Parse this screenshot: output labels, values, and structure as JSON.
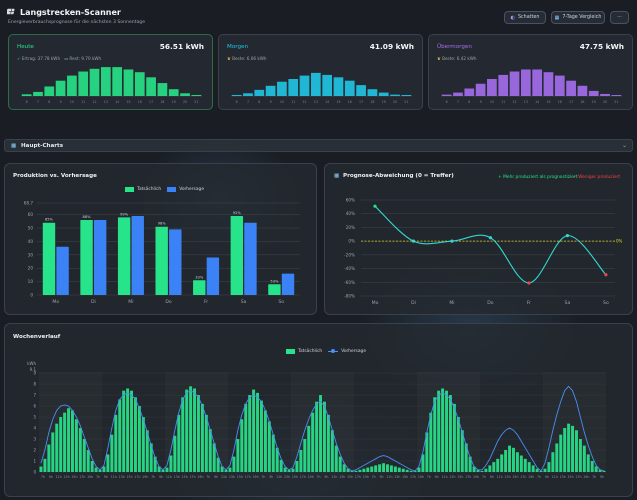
{
  "header": {
    "title": "Langstrecken-Scanner",
    "subtitle": "Energieverbrauchsprognose für die nächsten 3 Sonnentage",
    "btn_shade": "Schatten",
    "btn_compare": "7-Tage Vergleich",
    "btn_more": "···"
  },
  "colors": {
    "green": "#27e38a",
    "cyan": "#1fc7e6",
    "purple": "#a66ef0",
    "blue": "#3b82f6",
    "red": "#ef4444",
    "yellow": "#e6d21a"
  },
  "days": [
    {
      "name": "Heute",
      "value": "56.51 kWh",
      "meta1": "Ertrag: 37.78 kWh",
      "meta2": "Rest: 9.70 kWh",
      "color": "#27e38a",
      "bars": [
        0.05,
        0.12,
        0.28,
        0.45,
        0.6,
        0.72,
        0.8,
        0.85,
        0.85,
        0.78,
        0.7,
        0.55,
        0.38,
        0.2,
        0.08,
        0.03
      ]
    },
    {
      "name": "Morgen",
      "value": "41.09 kWh",
      "meta1": "Beste: 6.06 kWh",
      "color": "#1fc7e6",
      "bars": [
        0.03,
        0.08,
        0.18,
        0.3,
        0.42,
        0.5,
        0.6,
        0.68,
        0.62,
        0.55,
        0.45,
        0.32,
        0.2,
        0.1,
        0.04,
        0.02
      ]
    },
    {
      "name": "Übermorgen",
      "value": "47.75 kWh",
      "meta1": "Beste: 6.42 kWh",
      "color": "#a66ef0",
      "bars": [
        0.04,
        0.1,
        0.22,
        0.36,
        0.5,
        0.62,
        0.72,
        0.78,
        0.78,
        0.7,
        0.6,
        0.45,
        0.3,
        0.15,
        0.06,
        0.02
      ]
    }
  ],
  "day_hour_labels": [
    "6",
    "7",
    "8",
    "9",
    "10",
    "11",
    "12",
    "13",
    "14",
    "15",
    "16",
    "17",
    "18",
    "19",
    "20",
    "21"
  ],
  "section": {
    "title": "Haupt-Charts",
    "chevron": "⌄"
  },
  "chart_data": [
    {
      "type": "bar",
      "title": "Produktion vs. Vorhersage",
      "categories": [
        "Mo",
        "Di",
        "Mi",
        "Do",
        "Fr",
        "Sa",
        "So"
      ],
      "series": [
        {
          "name": "Tatsächlich",
          "values": [
            54,
            56,
            58,
            51,
            11,
            59,
            8
          ]
        },
        {
          "name": "Vorhersage",
          "values": [
            36,
            56,
            59,
            49,
            28,
            54,
            16
          ]
        }
      ],
      "data_labels": [
        "85%",
        "88%",
        "99%",
        "98%",
        "33%",
        "92%",
        "53%"
      ],
      "ylim": [
        0,
        68.7
      ],
      "yticks": [
        "0",
        "10",
        "20",
        "30",
        "40",
        "50",
        "60",
        "68.7"
      ],
      "grid": true,
      "legend": "top"
    },
    {
      "type": "line",
      "title": "Prognose-Abweichung (0 = Treffer)",
      "legend_plus": "+ Mehr produziert als prognostiziert",
      "legend_minus": "− Weniger produziert",
      "categories": [
        "Mo",
        "Di",
        "Mi",
        "Do",
        "Fr",
        "Sa",
        "So"
      ],
      "values": [
        51,
        0,
        0,
        5,
        -61,
        8,
        -49
      ],
      "ylim": [
        -80,
        60
      ],
      "yticks": [
        "60%",
        "40%",
        "20%",
        "0%",
        "-20%",
        "-40%",
        "-60%",
        "-80%"
      ],
      "zero_label": "0%",
      "grid": true
    },
    {
      "type": "bar",
      "title": "Wochenverlauf",
      "ylabel": "kWh",
      "ymax_label": "9.1",
      "yticks": [
        "0",
        "1",
        "2",
        "3",
        "4",
        "5",
        "6",
        "7",
        "8",
        "9"
      ],
      "ylim": [
        0,
        9.1
      ],
      "legend": [
        "Tatsächlich",
        "Vorhersage"
      ],
      "x_tick_pattern": [
        "7h",
        "9h",
        "11h",
        "13h",
        "15h",
        "17h",
        "19h"
      ],
      "series": [
        {
          "name": "Tatsächlich",
          "values": [
            0.5,
            1.2,
            2.5,
            3.6,
            4.4,
            5.0,
            5.4,
            5.8,
            5.6,
            4.8,
            4.0,
            3.0,
            2.0,
            1.0,
            0.4,
            0.2,
            0.5,
            1.6,
            3.4,
            5.2,
            6.6,
            7.4,
            7.6,
            7.4,
            6.8,
            6.0,
            5.0,
            3.8,
            2.6,
            1.4,
            0.5,
            0.2,
            0.4,
            1.5,
            3.3,
            5.2,
            6.8,
            7.5,
            7.8,
            7.6,
            7.0,
            6.2,
            5.2,
            3.9,
            2.6,
            1.3,
            0.5,
            0.2,
            0.4,
            1.4,
            3.0,
            4.8,
            6.2,
            7.0,
            7.5,
            7.2,
            6.5,
            5.6,
            4.6,
            3.4,
            2.2,
            1.1,
            0.4,
            0.2,
            0.3,
            1.0,
            2.0,
            3.0,
            4.2,
            5.4,
            6.4,
            7.0,
            6.4,
            5.2,
            3.8,
            2.4,
            1.4,
            0.7,
            0.3,
            0.1,
            0.1,
            0.2,
            0.3,
            0.4,
            0.5,
            0.6,
            0.7,
            0.8,
            0.7,
            0.6,
            0.5,
            0.4,
            0.3,
            0.2,
            0.1,
            0.1,
            0.4,
            1.6,
            3.6,
            5.4,
            6.8,
            7.4,
            7.6,
            7.4,
            7.0,
            6.2,
            5.0,
            3.8,
            2.6,
            1.4,
            0.5,
            0.2,
            0.1,
            0.3,
            0.6,
            0.9,
            1.2,
            1.6,
            2.0,
            2.4,
            2.2,
            1.8,
            1.5,
            1.2,
            0.9,
            0.6,
            0.3,
            0.1,
            0.3,
            0.9,
            1.8,
            2.6,
            3.4,
            4.0,
            4.4,
            4.2,
            3.8,
            3.0,
            2.4,
            1.6,
            1.0,
            0.5,
            0.2,
            0.1
          ]
        },
        {
          "name": "Vorhersage",
          "values": [
            0.8,
            2.0,
            3.6,
            4.8,
            5.6,
            6.0,
            6.1,
            6.0,
            5.6,
            5.0,
            4.2,
            3.2,
            2.2,
            1.2,
            0.5,
            0.2,
            0.6,
            2.2,
            4.0,
            5.6,
            6.6,
            7.0,
            7.2,
            7.0,
            6.6,
            5.8,
            4.8,
            3.6,
            2.4,
            1.3,
            0.5,
            0.2,
            0.6,
            2.0,
            3.8,
            5.4,
            6.6,
            7.2,
            7.4,
            7.2,
            6.8,
            6.0,
            5.0,
            3.8,
            2.6,
            1.4,
            0.5,
            0.2,
            0.6,
            2.0,
            3.8,
            5.2,
            6.2,
            6.8,
            7.0,
            6.8,
            6.4,
            5.6,
            4.6,
            3.4,
            2.2,
            1.2,
            0.5,
            0.2,
            0.4,
            1.4,
            2.6,
            3.8,
            4.8,
            5.6,
            6.2,
            6.4,
            6.0,
            5.0,
            3.8,
            2.6,
            1.6,
            0.8,
            0.3,
            0.1,
            0.2,
            0.4,
            0.6,
            0.8,
            1.0,
            1.2,
            1.4,
            1.5,
            1.4,
            1.2,
            1.0,
            0.8,
            0.6,
            0.4,
            0.2,
            0.1,
            0.5,
            1.8,
            3.6,
            5.2,
            6.4,
            7.0,
            7.2,
            7.0,
            6.6,
            5.8,
            4.8,
            3.6,
            2.4,
            1.3,
            0.5,
            0.2,
            0.2,
            0.6,
            1.2,
            2.0,
            2.8,
            3.4,
            3.8,
            4.0,
            3.8,
            3.4,
            2.8,
            2.2,
            1.6,
            1.0,
            0.4,
            0.1,
            0.8,
            2.2,
            3.8,
            5.2,
            6.4,
            7.4,
            7.8,
            7.4,
            6.4,
            5.0,
            3.6,
            2.4,
            1.4,
            0.6,
            0.2,
            0.1
          ]
        }
      ]
    }
  ]
}
